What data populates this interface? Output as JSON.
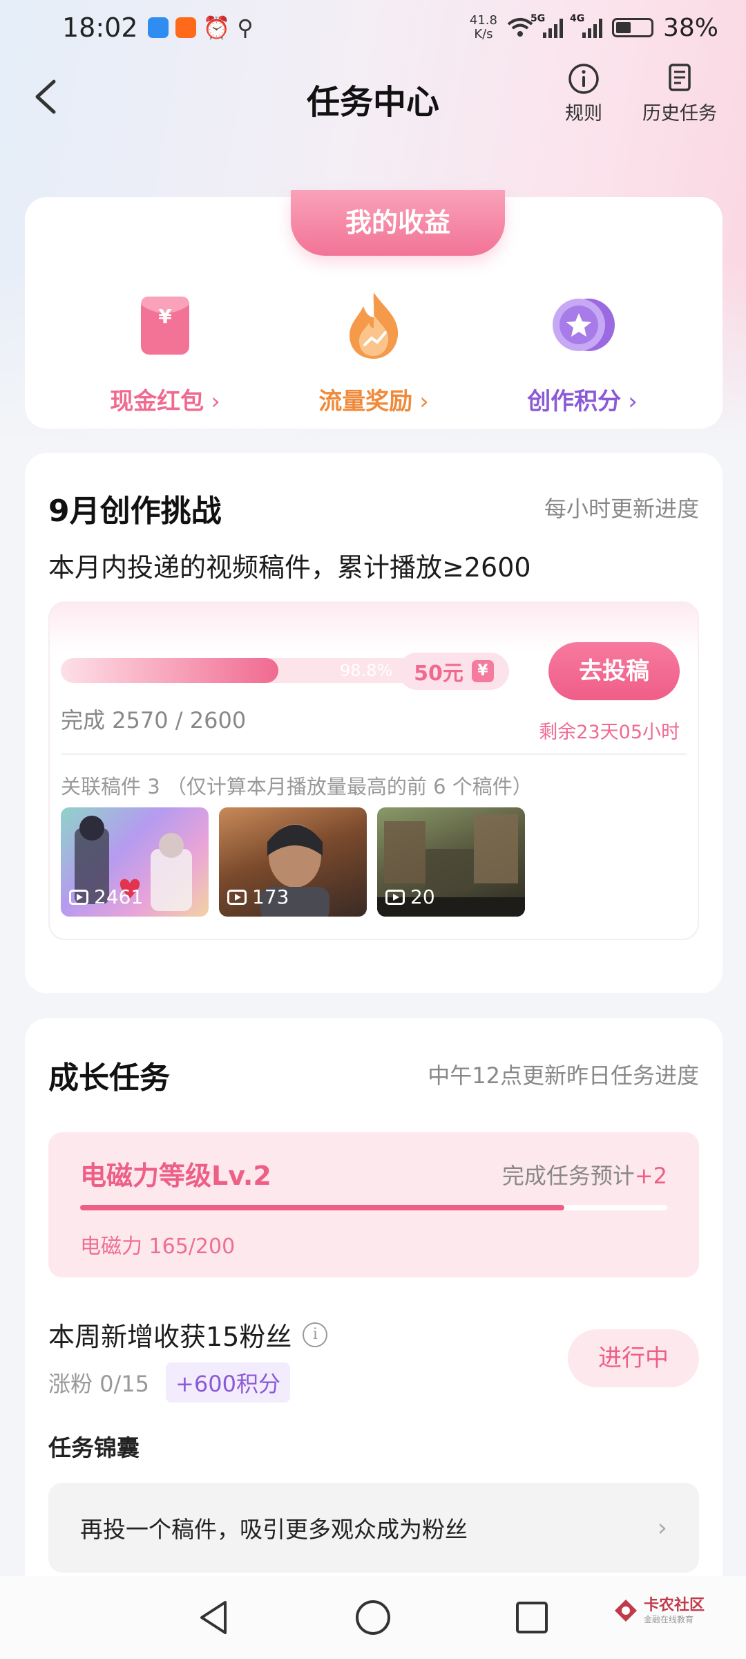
{
  "status_bar": {
    "time": "18:02",
    "net_speed_value": "41.8",
    "net_speed_unit": "K/s",
    "signal1_label": "5G",
    "signal2_label": "4G",
    "battery": "38%"
  },
  "header": {
    "title": "任务中心",
    "rules_label": "规则",
    "history_label": "历史任务"
  },
  "earnings": {
    "tab_label": "我的收益",
    "items": [
      {
        "label": "现金红包",
        "color": "#f06a90",
        "icon": "red-envelope-icon"
      },
      {
        "label": "流量奖励",
        "color": "#f08a3a",
        "icon": "flame-icon"
      },
      {
        "label": "创作积分",
        "color": "#8b5ad6",
        "icon": "star-coin-icon"
      }
    ]
  },
  "challenge": {
    "title": "9月创作挑战",
    "update_note": "每小时更新进度",
    "description": "本月内投递的视频稿件，累计播放≥2600",
    "progress_percent": 98.8,
    "progress_text": "98.8%",
    "reward": "50元",
    "reward_badge": "¥",
    "count_text": "完成 2570 / 2600",
    "submit_label": "去投稿",
    "remaining": "剩余23天05小时",
    "linked_note": "关联稿件 3 （仅计算本月播放量最高的前 6 个稿件）",
    "thumbnails": [
      {
        "views": "2461"
      },
      {
        "views": "173"
      },
      {
        "views": "20"
      }
    ]
  },
  "growth": {
    "title": "成长任务",
    "update_note": "中午12点更新昨日任务进度",
    "level_title": "电磁力等级Lv.2",
    "predict_prefix": "完成任务预计",
    "predict_value": "+2",
    "level_progress_fraction": 0.825,
    "level_value": "电磁力 165/200",
    "task_title": "本周新增收获15粉丝",
    "task_progress": "涨粉 0/15",
    "task_points": "+600积分",
    "task_status": "进行中",
    "tips_title": "任务锦囊",
    "tip_text": "再投一个稿件，吸引更多观众成为粉丝"
  },
  "watermark": {
    "main": "卡农社区",
    "sub": "金融在线教育"
  },
  "colors": {
    "pink": "#f06a90",
    "orange": "#f08a3a",
    "purple": "#8b5ad6"
  }
}
